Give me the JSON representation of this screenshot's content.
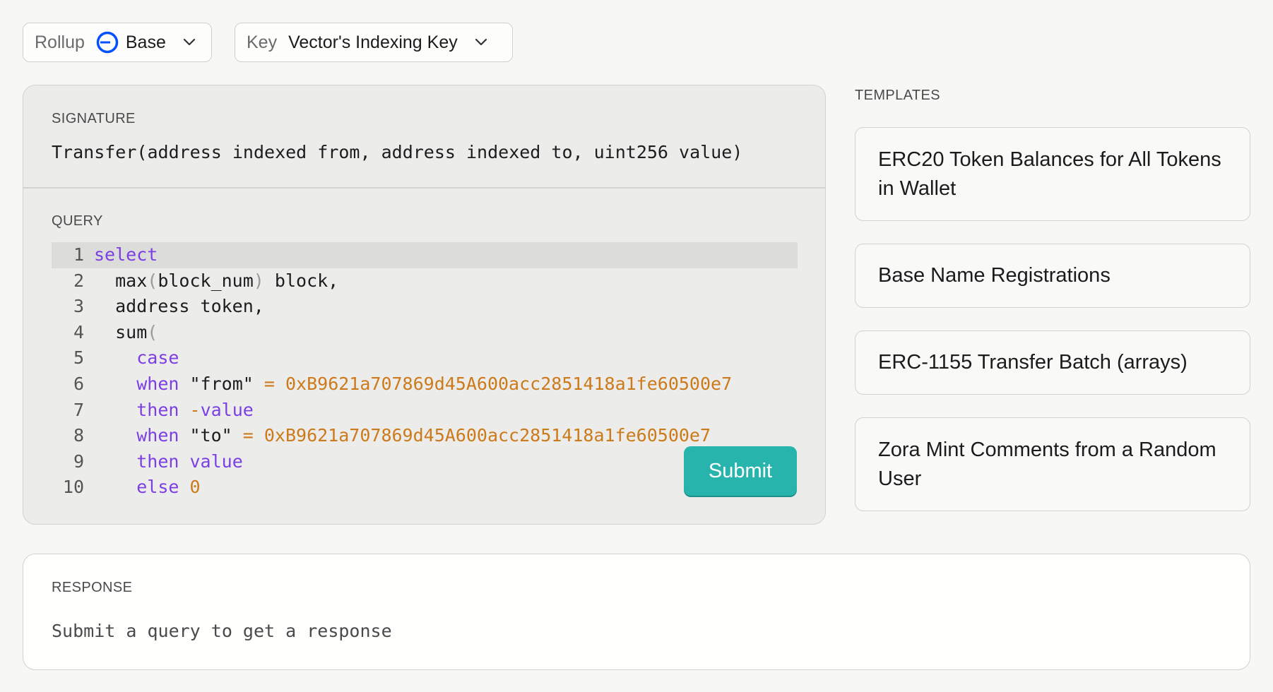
{
  "rollup": {
    "label": "Rollup",
    "value": "Base"
  },
  "key": {
    "label": "Key",
    "value": "Vector's Indexing Key"
  },
  "signature": {
    "label": "SIGNATURE",
    "text": "Transfer(address indexed from, address indexed to, uint256 value)"
  },
  "query": {
    "label": "QUERY",
    "lines": [
      {
        "n": "1",
        "parts": [
          {
            "t": "kw",
            "v": "select"
          }
        ]
      },
      {
        "n": "2",
        "parts": [
          {
            "t": "txt",
            "v": "  max"
          },
          {
            "t": "paren",
            "v": "("
          },
          {
            "t": "txt",
            "v": "block_num"
          },
          {
            "t": "paren",
            "v": ")"
          },
          {
            "t": "txt",
            "v": " block,"
          }
        ]
      },
      {
        "n": "3",
        "parts": [
          {
            "t": "txt",
            "v": "  address token,"
          }
        ]
      },
      {
        "n": "4",
        "parts": [
          {
            "t": "txt",
            "v": "  sum"
          },
          {
            "t": "paren",
            "v": "("
          }
        ]
      },
      {
        "n": "5",
        "parts": [
          {
            "t": "txt",
            "v": "    "
          },
          {
            "t": "kw",
            "v": "case"
          }
        ]
      },
      {
        "n": "6",
        "parts": [
          {
            "t": "txt",
            "v": "    "
          },
          {
            "t": "kw",
            "v": "when"
          },
          {
            "t": "txt",
            "v": " \"from\" "
          },
          {
            "t": "op",
            "v": "="
          },
          {
            "t": "txt",
            "v": " "
          },
          {
            "t": "hex",
            "v": "0xB9621a707869d45A600acc2851418a1fe60500e7"
          }
        ]
      },
      {
        "n": "7",
        "parts": [
          {
            "t": "txt",
            "v": "    "
          },
          {
            "t": "kw",
            "v": "then"
          },
          {
            "t": "txt",
            "v": " "
          },
          {
            "t": "op",
            "v": "-"
          },
          {
            "t": "kw",
            "v": "value"
          }
        ]
      },
      {
        "n": "8",
        "parts": [
          {
            "t": "txt",
            "v": "    "
          },
          {
            "t": "kw",
            "v": "when"
          },
          {
            "t": "txt",
            "v": " \"to\" "
          },
          {
            "t": "op",
            "v": "="
          },
          {
            "t": "txt",
            "v": " "
          },
          {
            "t": "hex",
            "v": "0xB9621a707869d45A600acc2851418a1fe60500e7"
          }
        ]
      },
      {
        "n": "9",
        "parts": [
          {
            "t": "txt",
            "v": "    "
          },
          {
            "t": "kw",
            "v": "then"
          },
          {
            "t": "txt",
            "v": " "
          },
          {
            "t": "kw",
            "v": "value"
          }
        ]
      },
      {
        "n": "10",
        "parts": [
          {
            "t": "txt",
            "v": "    "
          },
          {
            "t": "kw",
            "v": "else"
          },
          {
            "t": "txt",
            "v": " "
          },
          {
            "t": "hex",
            "v": "0"
          }
        ]
      }
    ]
  },
  "submit_label": "Submit",
  "templates": {
    "label": "TEMPLATES",
    "items": [
      "ERC20 Token Balances for All Tokens in Wallet",
      "Base Name Registrations",
      "ERC-1155 Transfer Batch (arrays)",
      "Zora Mint Comments from a Random User"
    ]
  },
  "response": {
    "label": "RESPONSE",
    "placeholder": "Submit a query to get a response"
  },
  "colors": {
    "accent": "#27b4ad",
    "keyword": "#7b3fe4",
    "literal": "#cd7a1a",
    "base_logo": "#0052ff"
  },
  "icons": {
    "rollup_logo": "base-logo-icon",
    "dropdown": "chevron-down-icon"
  }
}
